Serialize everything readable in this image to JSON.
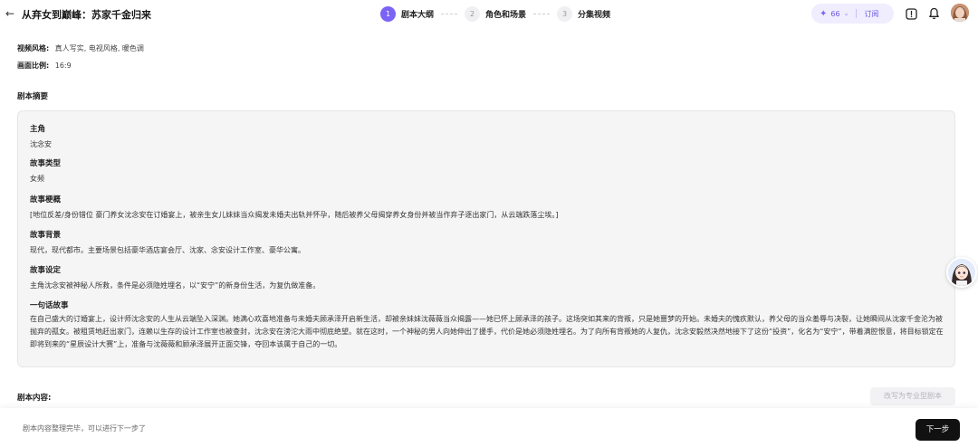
{
  "header": {
    "back_glyph": "←",
    "title": "从弃女到巅峰：苏家千金归来",
    "steps": [
      {
        "num": "1",
        "label": "剧本大纲",
        "active": true
      },
      {
        "num": "2",
        "label": "角色和场景",
        "active": false
      },
      {
        "num": "3",
        "label": "分集视频",
        "active": false
      }
    ],
    "credits": {
      "icon": "sparkle-icon",
      "count": "66",
      "subscribe_label": "订阅"
    },
    "icons": {
      "feedback": "alert-icon",
      "notifications": "bell-icon"
    }
  },
  "meta": {
    "style_key": "视频风格:",
    "style_value": "真人写实, 电视风格, 暖色调",
    "ratio_key": "画面比例:",
    "ratio_value": "16:9"
  },
  "summary": {
    "title": "剧本摘要",
    "protagonist_h": "主角",
    "protagonist_v": "沈念安",
    "genre_h": "故事类型",
    "genre_v": "女频",
    "synopsis_h": "故事梗概",
    "synopsis_v": "[地位反差/身份错位 豪门养女沈念安在订婚宴上，被亲生女儿妹妹当众揭发未婚夫出轨并怀孕，随后被养父母揭穿养女身份并被当作弃子逐出家门，从云端跌落尘埃。]",
    "background_h": "故事背景",
    "background_v": "现代，现代都市。主要场景包括豪华酒店宴会厅、沈家、念安设计工作室、豪华公寓。",
    "setting_h": "故事设定",
    "setting_v": "主角沈念安被神秘人所救，条件是必须隐姓埋名，以“安宁”的新身份生活，为复仇做准备。",
    "oneline_h": "一句话故事",
    "oneline_v": "在自己盛大的订婚宴上，设计师沈念安的人生从云端坠入深渊。她满心欢喜地准备与未婚夫顾承泽开启新生活，却被亲妹妹沈薇薇当众揭露——她已怀上顾承泽的孩子。这场突如其来的背叛，只是她噩梦的开始。未婚夫的愧疚默认，养父母的当众羞辱与决裂，让她瞬间从沈家千金沦为被抛弃的孤女。被租赁地赶出家门，连赖以生存的设计工作室也被查封，沈念安在滂沱大雨中彻底绝望。就在这时，一个神秘的男人向她伸出了援手，代价是她必须隐姓埋名。为了向所有背叛她的人复仇，沈念安毅然决然地接下了这份“投资”，化名为“安宁”，带着满腔恨意，将目标锁定在即将到来的“星辰设计大赛”上，准备与沈薇薇和顾承泽展开正面交锋，夺回本该属于自己的一切。"
  },
  "content": {
    "label": "剧本内容:",
    "convert_label": "改写为专业型剧本"
  },
  "footer": {
    "hint": "剧本内容整理完毕，可以进行下一步了",
    "next_label": "下一步"
  },
  "colors": {
    "accent": "#7a63f5",
    "accent_bg": "#f0edff",
    "card_bg": "#f5f5f5",
    "primary_btn": "#111111"
  }
}
